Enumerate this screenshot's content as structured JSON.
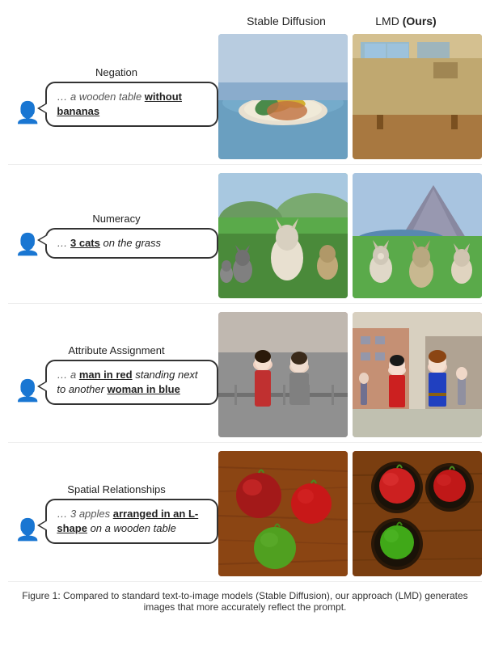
{
  "header": {
    "col1": "Stable Diffusion",
    "col2_normal": "LMD ",
    "col2_bold": "(Ours)"
  },
  "rows": [
    {
      "id": "negation",
      "category": "Negation",
      "speech": {
        "prefix": "… a wooden table ",
        "highlighted": "without bananas",
        "suffix": ""
      }
    },
    {
      "id": "numeracy",
      "category": "Numeracy",
      "speech": {
        "prefix": "… ",
        "highlighted": "3 cats",
        "suffix": " on the grass"
      }
    },
    {
      "id": "attribute",
      "category": "Attribute Assignment",
      "speech": {
        "prefix": "… a ",
        "highlighted": "man in red",
        "suffix": " standing next to another ",
        "highlighted2": "woman in blue",
        "suffix2": ""
      }
    },
    {
      "id": "spatial",
      "category": "Spatial Relationships",
      "speech": {
        "prefix": "… 3 apples ",
        "highlighted": "arranged in an L-shape",
        "suffix": " on a wooden table"
      }
    }
  ],
  "footer": "Figure 1: Compared to standard text-to-image models (Stable Diffusion), our approach (LMD) generates images that more accurately reflect the prompt."
}
